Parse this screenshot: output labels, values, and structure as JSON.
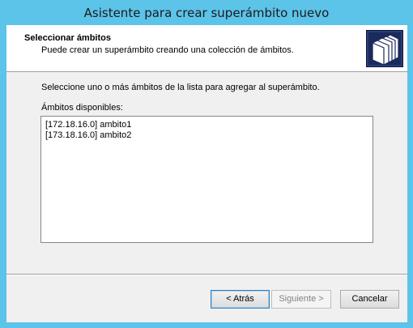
{
  "window": {
    "title": "Asistente para crear superámbito nuevo"
  },
  "header": {
    "title": "Seleccionar ámbitos",
    "subtitle": "Puede crear un superámbito creando una colección de ámbitos.",
    "icon": "folder-stack-icon"
  },
  "main": {
    "instruction": "Seleccione uno o más ámbitos de la lista para agregar al superámbito.",
    "list_label": "Ámbitos disponibles:",
    "scopes": [
      "[172.18.16.0] ambito1",
      "[173.18.16.0] ambito2"
    ]
  },
  "buttons": {
    "back": "< Atrás",
    "next": "Siguiente >",
    "cancel": "Cancelar"
  },
  "colors": {
    "title_bar": "#5cc3e9",
    "dialog_background": "#f0f0f0",
    "header_background": "#ffffff",
    "icon_background": "#1b2a5c"
  }
}
